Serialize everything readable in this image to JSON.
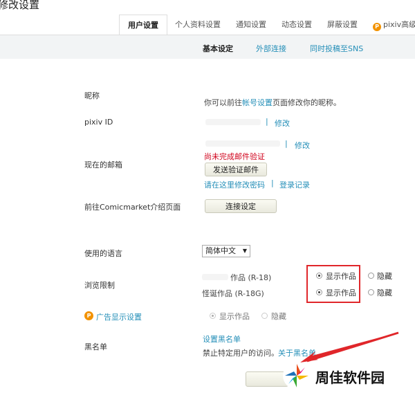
{
  "page_title": "修改设置",
  "tabs": [
    "用户设置",
    "个人资料设置",
    "通知设置",
    "动态设置",
    "屏蔽设置",
    "pixiv高级"
  ],
  "subnav": [
    "基本设定",
    "外部连接",
    "同时投稿至SNS"
  ],
  "nickname": {
    "label": "昵称",
    "prefix": "你可以前往",
    "link": "帐号设置",
    "suffix": "页面修改你的昵称。"
  },
  "pixiv_id": {
    "label": "pixiv ID",
    "edit": "修改"
  },
  "email": {
    "label": "现在的邮箱",
    "edit": "修改",
    "warning": "尚未完成邮件验证",
    "send_button": "发送验证邮件",
    "change_password": "请在这里修改密码",
    "login_history": "登录记录"
  },
  "comicmarket": {
    "label": "前往Comicmarket介绍页面",
    "button": "连接设定"
  },
  "language": {
    "label": "使用的语言",
    "value": "简体中文"
  },
  "browse_limit": {
    "label": "浏览限制",
    "row1_label": "作品 (R-18)",
    "row2_label": "怪诞作品 (R-18G)",
    "show": "显示作品",
    "hide": "隐藏"
  },
  "ads": {
    "label": "广告显示设置",
    "show": "显示作品",
    "hide": "隐藏"
  },
  "blacklist": {
    "label": "黑名单",
    "set_link": "设置黑名单",
    "desc": "禁止特定用户的访问。",
    "about": "关于黑名单"
  },
  "watermark": {
    "text": "周佳软件园"
  },
  "colors": {
    "link": "#258fb8",
    "warning": "#d0021b",
    "highlight": "#e0262a",
    "accent": "#f29200"
  }
}
